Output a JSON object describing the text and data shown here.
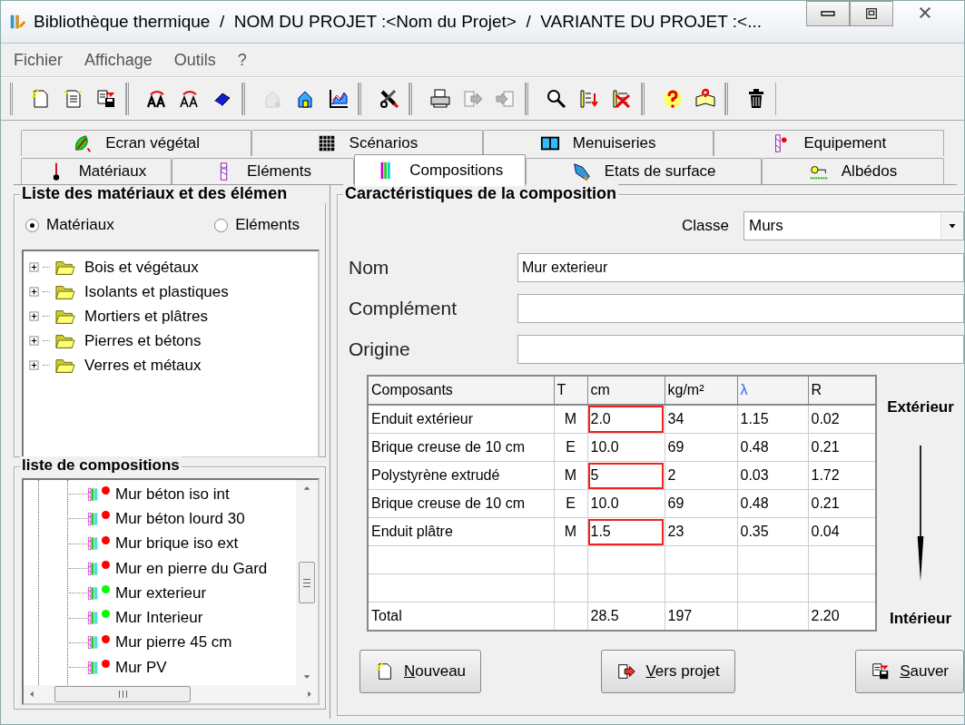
{
  "window": {
    "title": "Bibliothèque thermique  /  NOM DU PROJET :<Nom du Projet>  /  VARIANTE DU PROJET :<..."
  },
  "menu": [
    "Fichier",
    "Affichage",
    "Outils",
    "?"
  ],
  "toolbar": [
    [
      {
        "kind": "new",
        "disabled": false
      },
      {
        "kind": "file",
        "disabled": false
      },
      {
        "kind": "save",
        "disabled": false
      }
    ],
    [
      {
        "kind": "font-swap",
        "disabled": false
      },
      {
        "kind": "font-refresh",
        "disabled": false
      },
      {
        "kind": "eraser",
        "disabled": false
      }
    ],
    [
      {
        "kind": "house",
        "disabled": true
      },
      {
        "kind": "house-chart",
        "disabled": false
      },
      {
        "kind": "chart",
        "disabled": false
      }
    ],
    [
      {
        "kind": "tools",
        "disabled": false
      }
    ],
    [
      {
        "kind": "print",
        "disabled": false
      },
      {
        "kind": "export",
        "disabled": true
      },
      {
        "kind": "import",
        "disabled": true
      }
    ],
    [
      {
        "kind": "search",
        "disabled": false
      },
      {
        "kind": "sort",
        "disabled": false
      },
      {
        "kind": "delete-list",
        "disabled": false
      }
    ],
    [
      {
        "kind": "help",
        "disabled": false
      },
      {
        "kind": "help-book",
        "disabled": false
      }
    ],
    [
      {
        "kind": "trash",
        "disabled": false
      }
    ]
  ],
  "tab_rows": [
    [
      {
        "label": "Ecran végétal",
        "kind": "leaf",
        "selected": false
      },
      {
        "label": "Scénarios",
        "kind": "grid",
        "selected": false
      },
      {
        "label": "Menuiseries",
        "kind": "window",
        "selected": false
      },
      {
        "label": "Equipement",
        "kind": "equipment",
        "selected": false
      }
    ],
    [
      {
        "label": "Matériaux",
        "kind": "probe",
        "selected": false
      },
      {
        "label": "Eléments",
        "kind": "element",
        "selected": false
      },
      {
        "label": "Compositions",
        "kind": "layers",
        "selected": true
      },
      {
        "label": "Etats de surface",
        "kind": "brush",
        "selected": false
      },
      {
        "label": "Albédos",
        "kind": "sun",
        "selected": false
      }
    ]
  ],
  "materials_panel": {
    "title": "Liste des matériaux et des élémen",
    "radios": [
      {
        "label": "Matériaux",
        "selected": true
      },
      {
        "label": "Eléments",
        "selected": false
      }
    ],
    "tree": [
      {
        "label": "Bois et végétaux",
        "expanded": false
      },
      {
        "label": "Isolants et plastiques",
        "expanded": false
      },
      {
        "label": "Mortiers et plâtres",
        "expanded": false
      },
      {
        "label": "Pierres et bétons",
        "expanded": false
      },
      {
        "label": "Verres et métaux",
        "expanded": false
      }
    ]
  },
  "compositions_panel": {
    "title": "liste de compositions",
    "items": [
      {
        "label": "Mur béton iso int",
        "color": "#ff0000"
      },
      {
        "label": "Mur béton lourd 30",
        "color": "#ff0000"
      },
      {
        "label": "Mur brique iso ext",
        "color": "#ff0000"
      },
      {
        "label": "Mur en pierre du Gard",
        "color": "#ff0000"
      },
      {
        "label": "Mur exterieur",
        "color": "#00ff00"
      },
      {
        "label": "Mur Interieur",
        "color": "#00ff00"
      },
      {
        "label": "Mur pierre 45 cm",
        "color": "#ff0000"
      },
      {
        "label": "Mur PV",
        "color": "#ff0000"
      }
    ]
  },
  "composition": {
    "title": "Caractéristiques de la composition",
    "class_label": "Classe",
    "class_value": "Murs",
    "fields": [
      {
        "label": "Nom",
        "value": "Mur exterieur"
      },
      {
        "label": "Complément"
      },
      {
        "label": "Origine"
      }
    ],
    "table": {
      "columns": [
        "Composants",
        "T",
        "cm",
        "kg/m²",
        "λ",
        "R"
      ],
      "rows": [
        {
          "cells": [
            "Enduit extérieur",
            "M",
            "2.0",
            "34",
            "1.15",
            "0.02"
          ],
          "flagged": true
        },
        {
          "cells": [
            "Brique creuse de 10 cm",
            "E",
            "10.0",
            "69",
            "0.48",
            "0.21"
          ],
          "flagged": false
        },
        {
          "cells": [
            "Polystyrène extrudé",
            "M",
            "5",
            "2",
            "0.03",
            "1.72"
          ],
          "flagged": true
        },
        {
          "cells": [
            "Brique creuse de 10 cm",
            "E",
            "10.0",
            "69",
            "0.48",
            "0.21"
          ],
          "flagged": false
        },
        {
          "cells": [
            "Enduit plâtre",
            "M",
            "1.5",
            "23",
            "0.35",
            "0.04"
          ],
          "flagged": true
        }
      ],
      "total": {
        "label": "Total",
        "cm": "28.5",
        "mass": "197",
        "r": "2.20"
      }
    },
    "side_labels": {
      "top": "Extérieur",
      "bottom": "Intérieur"
    },
    "buttons": [
      {
        "kind": "new",
        "key": "N",
        "rest": "ouveau"
      },
      {
        "kind": "export",
        "key": "V",
        "rest": "ers projet"
      },
      {
        "kind": "save",
        "key": "S",
        "rest": "auver"
      }
    ]
  }
}
